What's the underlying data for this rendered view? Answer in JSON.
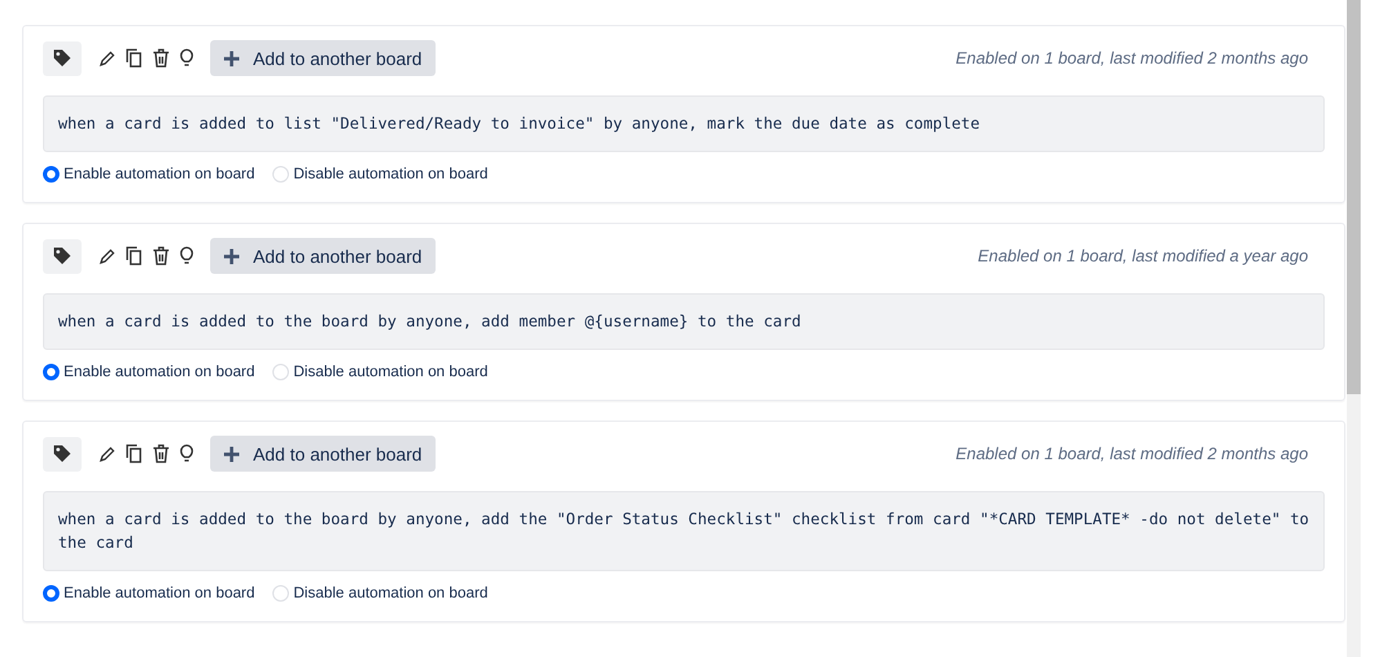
{
  "rules": [
    {
      "add_button": "Add to another board",
      "meta": "Enabled on 1 board, last modified 2 months ago",
      "rule_text": "when a card is added to list \"Delivered/Ready to invoice\" by anyone, mark the due date as complete",
      "options": [
        {
          "label": "Enable automation on board",
          "selected": true
        },
        {
          "label": "Disable automation on board",
          "selected": false
        }
      ]
    },
    {
      "add_button": "Add to another board",
      "meta": "Enabled on 1 board, last modified a year ago",
      "rule_text": "when a card is added to the board by anyone, add member @{username} to the card",
      "options": [
        {
          "label": "Enable automation on board",
          "selected": true
        },
        {
          "label": "Disable automation on board",
          "selected": false
        }
      ]
    },
    {
      "add_button": "Add to another board",
      "meta": "Enabled on 1 board, last modified 2 months ago",
      "rule_text": "when a card is added to the board by anyone, add the \"Order Status Checklist\" checklist from card \"*CARD TEMPLATE* -do not delete\" to the card",
      "options": [
        {
          "label": "Enable automation on board",
          "selected": true
        },
        {
          "label": "Disable automation on board",
          "selected": false
        }
      ]
    }
  ]
}
